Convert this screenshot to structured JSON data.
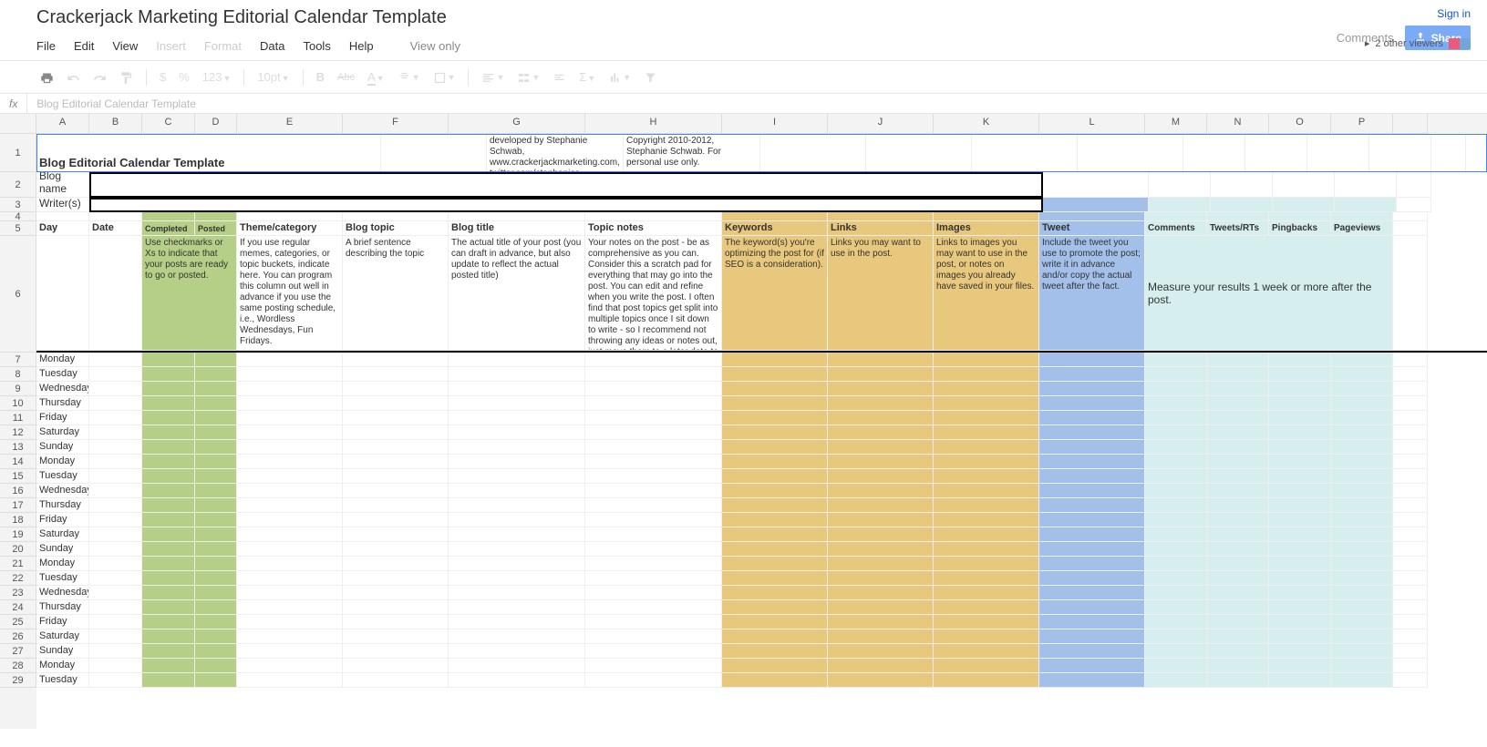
{
  "header": {
    "title": "Crackerjack Marketing Editorial Calendar Template",
    "signin": "Sign in",
    "comments": "Comments",
    "share": "Share",
    "viewers_label": "2 other viewers"
  },
  "menu": {
    "file": "File",
    "edit": "Edit",
    "view": "View",
    "insert": "Insert",
    "format": "Format",
    "data": "Data",
    "tools": "Tools",
    "help": "Help",
    "view_only": "View only"
  },
  "toolbar": {
    "dollar": "$",
    "percent": "%",
    "numfmt": "123",
    "fontsize": "10pt",
    "bold": "B",
    "strike": "Abc",
    "underlineA": "A"
  },
  "formula": {
    "fx": "fx",
    "value": "Blog Editorial Calendar Template"
  },
  "columns": [
    "A",
    "B",
    "C",
    "D",
    "E",
    "F",
    "G",
    "H",
    "I",
    "J",
    "K",
    "L",
    "M",
    "N",
    "O",
    "P",
    ""
  ],
  "row1": {
    "title": "Blog Editorial Calendar Template",
    "credit": "developed by Stephanie Schwab, www.crackerjackmarketing.com, twitter.com/stephanies",
    "copyright": "Copyright 2010-2012, Stephanie Schwab. For personal use only."
  },
  "row2": {
    "label": "Blog name"
  },
  "row3": {
    "label": "Writer(s)"
  },
  "headers": {
    "day": "Day",
    "date": "Date",
    "completed": "Completed",
    "posted": "Posted",
    "theme": "Theme/category",
    "topic": "Blog topic",
    "title": "Blog title",
    "notes": "Topic notes",
    "keywords": "Keywords",
    "links": "Links",
    "images": "Images",
    "tweet": "Tweet",
    "comments": "Comments",
    "tweets_rts": "Tweets/RTs",
    "pingbacks": "Pingbacks",
    "pageviews": "Pageviews"
  },
  "descriptions": {
    "completed": "Use checkmarks or Xs to indicate that your posts are ready to go or posted.",
    "theme": "If you use regular memes, categories, or topic buckets, indicate here. You can program this column out well in advance if you use the same posting schedule, i.e., Wordless Wednesdays, Fun Fridays.",
    "topic": "A brief sentence describing the topic",
    "title": "The actual title of your post (you can draft in advance, but also update to reflect the actual posted title)",
    "notes": "Your notes on the post - be as comprehensive as you can. Consider this a scratch pad for everything that may go into the post. You can edit and refine when you write the post. I often find that post topics get split into multiple topics once I sit down to write - so I recommend not throwing any ideas or notes out, just move them to a later date to spark a new post.",
    "keywords": "The keyword(s) you're optimizing the post for (if SEO is a consideration).",
    "links": "Links you may want to use in the post.",
    "images": "Links to images you may want to use in the post, or notes on images you already have saved in your files.",
    "tweet": "Include the tweet you use to promote the post; write it in advance and/or copy the actual tweet after the fact.",
    "measure": "Measure your results 1 week or more after the post."
  },
  "days": [
    "Monday",
    "Tuesday",
    "Wednesday",
    "Thursday",
    "Friday",
    "Saturday",
    "Sunday",
    "Monday",
    "Tuesday",
    "Wednesday",
    "Thursday",
    "Friday",
    "Saturday",
    "Sunday",
    "Monday",
    "Tuesday",
    "Wednesday",
    "Thursday",
    "Friday",
    "Saturday",
    "Sunday",
    "Monday",
    "Tuesday"
  ]
}
